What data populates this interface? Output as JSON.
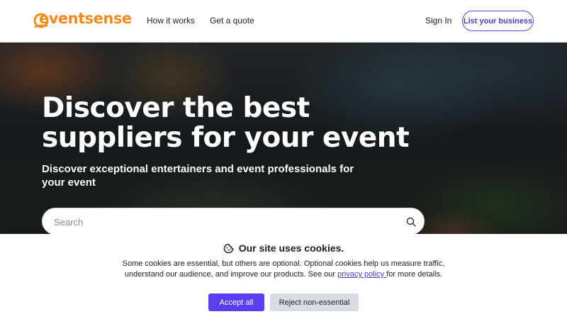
{
  "header": {
    "logo_text": "eventsense",
    "nav": [
      {
        "label": "How it works"
      },
      {
        "label": "Get a quote"
      }
    ],
    "sign_in_label": "Sign In",
    "list_business_label": "List your business"
  },
  "hero": {
    "title": "Discover the best suppliers for your event",
    "subtitle": "Discover exceptional entertainers and event professionals for your event",
    "search": {
      "placeholder": "Search",
      "value": ""
    }
  },
  "cookie_banner": {
    "title": "Our site uses cookies.",
    "text_before_link": "Some cookies are essential, but others are optional. Optional cookies help us measure traffic, understand our audience, and improve our products. See our ",
    "link_label": "privacy policy ",
    "text_after_link": "for more details.",
    "accept_label": "Accept all",
    "reject_label": "Reject non-essential"
  },
  "colors": {
    "brand_orange": "#f08a1c",
    "accent_purple": "#5b3ef0",
    "reject_gray": "#d9dde3"
  },
  "icons": [
    "logo-mark-icon",
    "search-icon",
    "cookie-icon"
  ]
}
